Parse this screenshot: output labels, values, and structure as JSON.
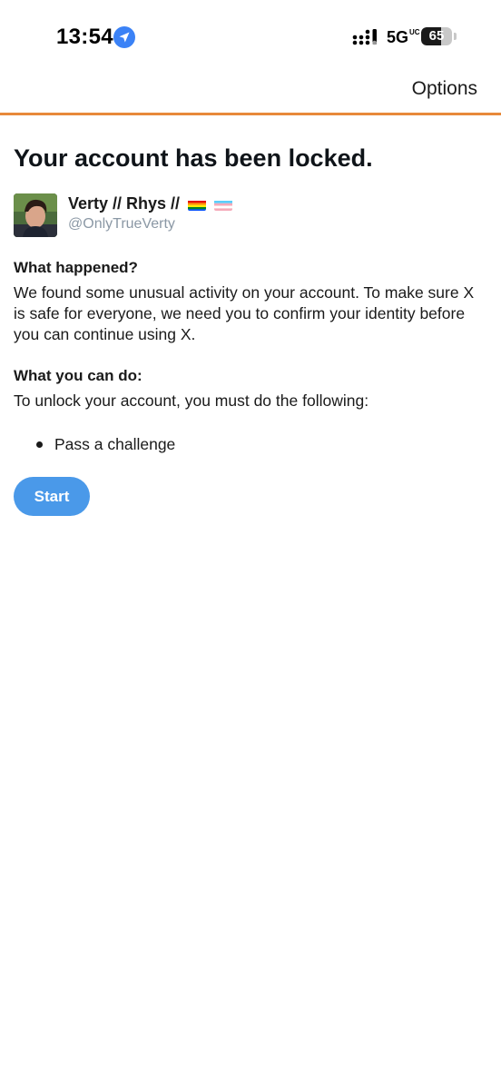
{
  "status_bar": {
    "time": "13:54",
    "network": "5G",
    "network_suffix": "UC",
    "battery_percent": "65",
    "battery_level": 0.65,
    "location_icon": "location-arrow-icon",
    "signal_icon": "cellular-signal-icon"
  },
  "header": {
    "options_label": "Options",
    "accent_color": "#e8893a"
  },
  "main": {
    "title": "Your account has been locked.",
    "account": {
      "display_name": "Verty // Rhys //",
      "handle": "@OnlyTrueVerty",
      "flags": [
        "rainbow-flag-icon",
        "transgender-flag-icon"
      ]
    },
    "what_happened": {
      "heading": "What happened?",
      "body": "We found some unusual activity on your account. To make sure X is safe for everyone, we need you to confirm your identity before you can continue using X."
    },
    "what_you_can_do": {
      "heading": "What you can do:",
      "body": "To unlock your account, you must do the following:",
      "tasks": [
        "Pass a challenge"
      ]
    },
    "start_button_label": "Start",
    "button_color": "#4a99e9"
  }
}
